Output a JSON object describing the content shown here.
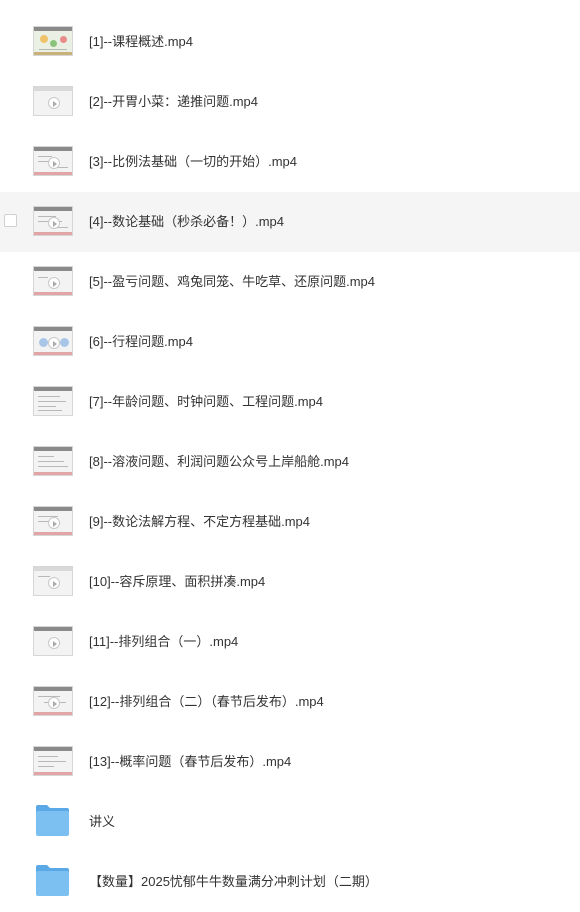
{
  "files": [
    {
      "name": "[1]--课程概述.mp4",
      "type": "video"
    },
    {
      "name": "[2]--开胃小菜：递推问题.mp4",
      "type": "video"
    },
    {
      "name": "[3]--比例法基础（一切的开始）.mp4",
      "type": "video"
    },
    {
      "name": "[4]--数论基础（秒杀必备！）.mp4",
      "type": "video"
    },
    {
      "name": "[5]--盈亏问题、鸡兔同笼、牛吃草、还原问题.mp4",
      "type": "video"
    },
    {
      "name": "[6]--行程问题.mp4",
      "type": "video"
    },
    {
      "name": "[7]--年龄问题、时钟问题、工程问题.mp4",
      "type": "video"
    },
    {
      "name": "[8]--溶液问题、利润问题公众号上岸船舱.mp4",
      "type": "video"
    },
    {
      "name": "[9]--数论法解方程、不定方程基础.mp4",
      "type": "video"
    },
    {
      "name": "[10]--容斥原理、面积拼凑.mp4",
      "type": "video"
    },
    {
      "name": "[11]--排列组合（一）.mp4",
      "type": "video"
    },
    {
      "name": "[12]--排列组合（二）（春节后发布）.mp4",
      "type": "video"
    },
    {
      "name": "[13]--概率问题（春节后发布）.mp4",
      "type": "video"
    },
    {
      "name": "讲义",
      "type": "folder"
    },
    {
      "name": "【数量】2025忧郁牛牛数量满分冲刺计划（二期）",
      "type": "folder"
    }
  ],
  "colors": {
    "hover_row": "#f5f5f5",
    "folder_front": "#7cc0f2",
    "folder_back": "#5aa9e6",
    "text": "#333333"
  }
}
